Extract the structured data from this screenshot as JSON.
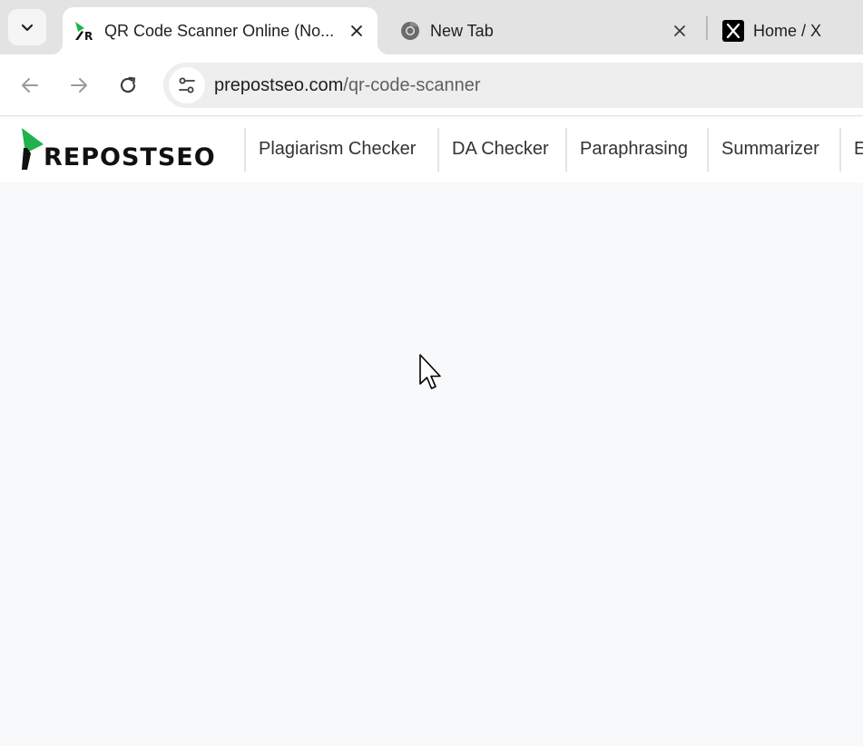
{
  "browser": {
    "tabs": [
      {
        "title": "QR Code Scanner Online (No...",
        "active": true,
        "favicon": "prepostseo-favicon"
      },
      {
        "title": "New Tab",
        "active": false,
        "favicon": "chrome-icon"
      },
      {
        "title": "Home / X",
        "active": false,
        "favicon": "x-logo-icon"
      }
    ],
    "url_domain": "prepostseo.com",
    "url_path": "/qr-code-scanner"
  },
  "site": {
    "logo_text": "REPOSTSEO",
    "brand_color": "#22b14c",
    "nav": [
      {
        "label": "Plagiarism Checker"
      },
      {
        "label": "DA Checker"
      },
      {
        "label": "Paraphrasing"
      },
      {
        "label": "Summarizer"
      },
      {
        "label": "E"
      }
    ]
  }
}
